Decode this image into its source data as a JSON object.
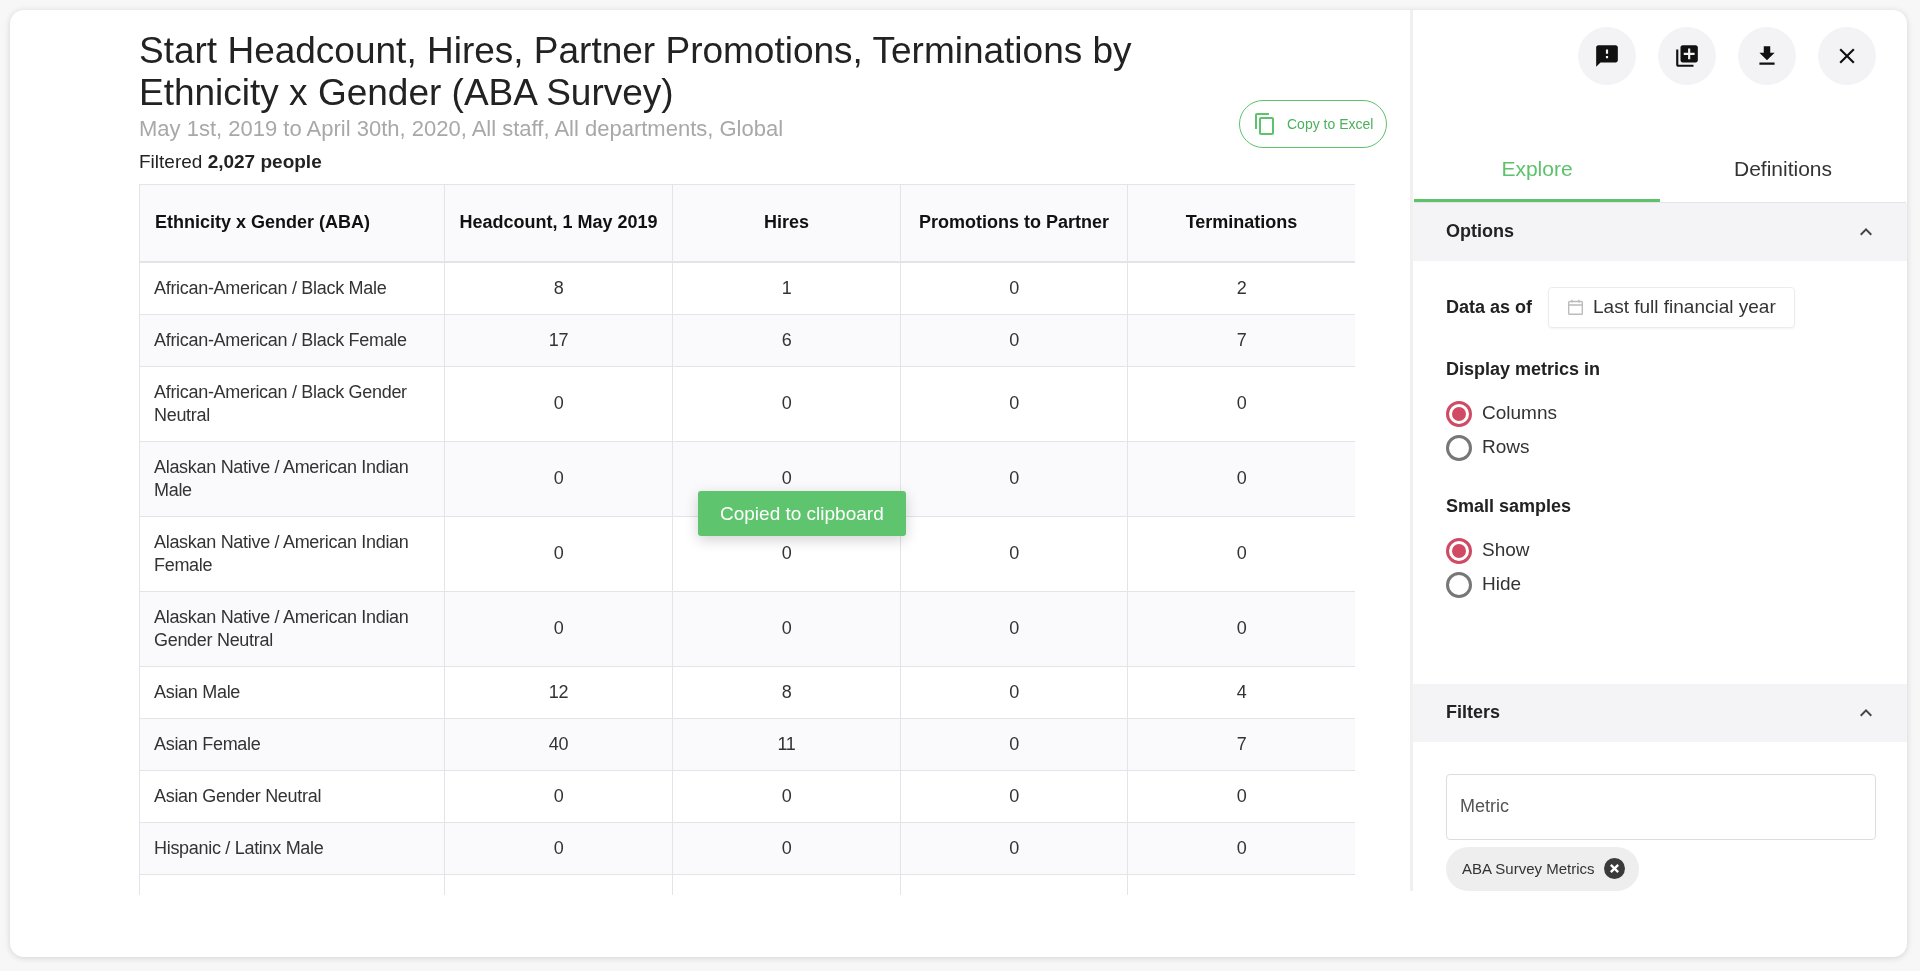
{
  "header": {
    "title": "Start Headcount, Hires, Partner Promotions, Terminations by Ethnicity x Gender (ABA Survey)",
    "subtitle": "May 1st, 2019 to April 30th, 2020, All staff, All departments, Global",
    "filtered_label": "Filtered",
    "filtered_count": "2,027 people",
    "copy_button": "Copy to Excel"
  },
  "table": {
    "columns": [
      "Ethnicity x Gender (ABA)",
      "Headcount, 1 May 2019",
      "Hires",
      "Promotions to Partner",
      "Terminations"
    ],
    "rows": [
      {
        "cells": [
          "African-American / Black Male",
          "8",
          "1",
          "0",
          "2"
        ]
      },
      {
        "cells": [
          "African-American / Black Female",
          "17",
          "6",
          "0",
          "7"
        ]
      },
      {
        "cells": [
          "African-American / Black Gender Neutral",
          "0",
          "0",
          "0",
          "0"
        ]
      },
      {
        "cells": [
          "Alaskan Native / American Indian Male",
          "0",
          "0",
          "0",
          "0"
        ]
      },
      {
        "cells": [
          "Alaskan Native / American Indian Female",
          "0",
          "0",
          "0",
          "0"
        ]
      },
      {
        "cells": [
          "Alaskan Native / American Indian Gender Neutral",
          "0",
          "0",
          "0",
          "0"
        ]
      },
      {
        "cells": [
          "Asian Male",
          "12",
          "8",
          "0",
          "4"
        ]
      },
      {
        "cells": [
          "Asian Female",
          "40",
          "11",
          "0",
          "7"
        ]
      },
      {
        "cells": [
          "Asian Gender Neutral",
          "0",
          "0",
          "0",
          "0"
        ]
      },
      {
        "cells": [
          "Hispanic / Latinx Male",
          "0",
          "0",
          "0",
          "0"
        ]
      }
    ]
  },
  "toast": "Copied to clipboard",
  "panel": {
    "actions": [
      {
        "kind": "feedback"
      },
      {
        "kind": "add"
      },
      {
        "kind": "download"
      },
      {
        "kind": "close"
      }
    ],
    "tabs": [
      {
        "label": "Explore",
        "selected": true
      },
      {
        "label": "Definitions",
        "selected": false
      }
    ],
    "options": {
      "title": "Options",
      "expanded": true,
      "data_as_of_label": "Data as of",
      "data_as_of_value": "Last full financial year",
      "groups": [
        {
          "label": "Display metrics in",
          "choices": [
            {
              "label": "Columns",
              "selected": true
            },
            {
              "label": "Rows",
              "selected": false
            }
          ]
        },
        {
          "label": "Small samples",
          "choices": [
            {
              "label": "Show",
              "selected": true
            },
            {
              "label": "Hide",
              "selected": false
            }
          ]
        }
      ]
    },
    "filters": {
      "title": "Filters",
      "expanded": true,
      "field_placeholder": "Metric",
      "chips": [
        "ABA Survey Metrics"
      ]
    }
  }
}
